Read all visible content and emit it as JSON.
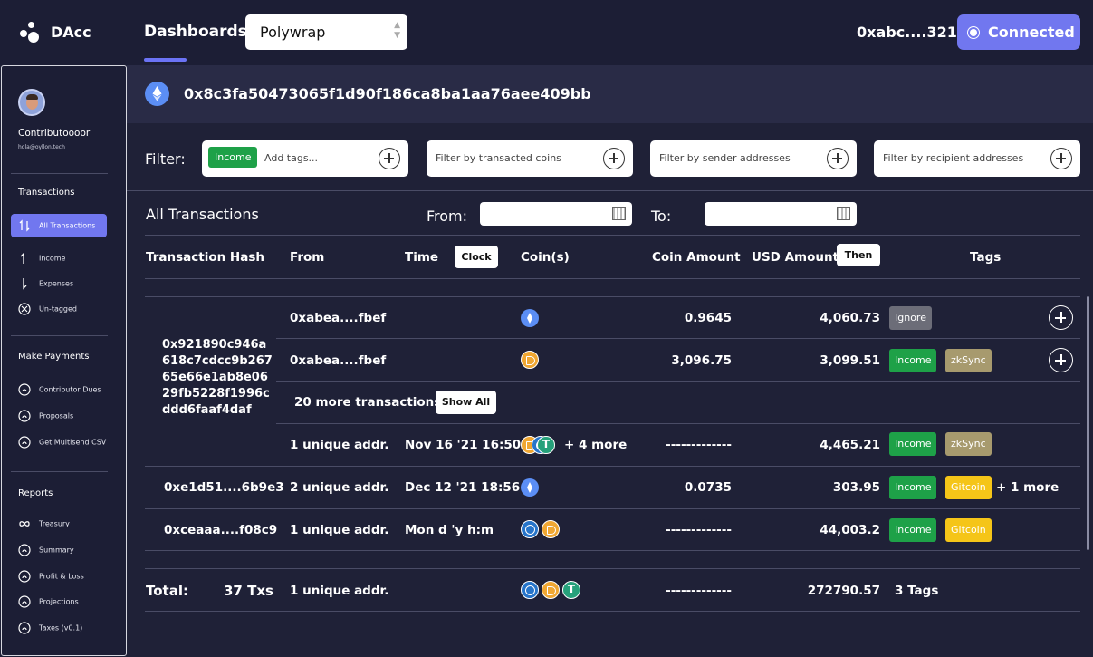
{
  "app": {
    "brand": "DAcc"
  },
  "header": {
    "dashboards_label": "Dashboards:",
    "dashboard_selected": "Polywrap",
    "wallet": "0xabc....321",
    "connected_label": "Connected"
  },
  "sidebar": {
    "user_name": "Contributoooor",
    "user_email": "hola@oyllon.tech",
    "transactions_heading": "Transactions",
    "transactions_items": [
      {
        "label": "All Transactions",
        "icon": "swap-arrows-icon"
      },
      {
        "label": "Income",
        "icon": "arrow-up-icon"
      },
      {
        "label": "Expenses",
        "icon": "arrow-down-icon"
      },
      {
        "label": "Un-tagged",
        "icon": "circle-x-icon"
      }
    ],
    "payments_heading": "Make Payments",
    "payments_items": [
      {
        "label": "Contributor Dues",
        "icon": "gauge-icon"
      },
      {
        "label": "Proposals",
        "icon": "gauge-icon"
      },
      {
        "label": "Get Multisend CSV",
        "icon": "gauge-icon"
      }
    ],
    "reports_heading": "Reports",
    "reports_items": [
      {
        "label": "Treasury",
        "icon": "infinity-icon"
      },
      {
        "label": "Summary",
        "icon": "gauge-icon"
      },
      {
        "label": "Profit & Loss",
        "icon": "gauge-icon"
      },
      {
        "label": "Projections",
        "icon": "gauge-icon"
      },
      {
        "label": "Taxes (v0.1)",
        "icon": "gauge-icon"
      }
    ]
  },
  "address_bar": {
    "address": "0x8c3fa50473065f1d90f186ca8ba1aa76aee409bb"
  },
  "filters": {
    "label": "Filter:",
    "tag_chip": "Income",
    "tags_placeholder": "Add tags...",
    "coins_placeholder": "Filter by transacted coins",
    "sender_placeholder": "Filter by sender addresses",
    "recipient_placeholder": "Filter by recipient addresses"
  },
  "table_controls": {
    "title": "All Transactions",
    "from_label": "From:",
    "to_label": "To:"
  },
  "table": {
    "headers": {
      "hash": "Transaction Hash",
      "from": "From",
      "time": "Time",
      "time_toggle": "Clock",
      "coins": "Coin(s)",
      "coin_amount": "Coin Amount",
      "usd_amount": "USD Amount",
      "usd_toggle": "Then",
      "tags": "Tags"
    },
    "group": {
      "hash": "0x921890c946a618c7cdcc9b26765e66e1ab8e0629fb5228f1996cddd6faaf4daf",
      "rows": [
        {
          "from": "0xabea....fbef",
          "coin_amount": "0.9645",
          "usd_amount": "4,060.73",
          "tags": [
            "Ignore"
          ]
        },
        {
          "from": "0xabea....fbef",
          "coin_amount": "3,096.75",
          "usd_amount": "3,099.51",
          "tags": [
            "Income",
            "zkSync"
          ]
        }
      ],
      "more_text": "20 more transactions",
      "show_all": "Show All",
      "summary": {
        "from": "1 unique addr.",
        "time": "Nov 16 '21 16:50",
        "coins_more": "+ 4 more",
        "coin_amount": "-------------",
        "usd_amount": "4,465.21",
        "tags": [
          "Income",
          "zkSync"
        ]
      }
    },
    "rows": [
      {
        "hash": "0xe1d51....6b9e3",
        "from": "2 unique addr.",
        "time": "Dec 12 '21 18:56",
        "coin_amount": "0.0735",
        "usd_amount": "303.95",
        "tags": [
          "Income",
          "Gitcoin"
        ],
        "tags_more": "+ 1 more"
      },
      {
        "hash": "0xceaaa....f08c9",
        "from": "1 unique addr.",
        "time": "Mon d 'y h:m",
        "coin_amount": "-------------",
        "usd_amount": "44,003.2",
        "tags": [
          "Income",
          "Gitcoin"
        ]
      }
    ],
    "total": {
      "label": "Total:",
      "count": "37 Txs",
      "from": "1 unique addr.",
      "coin_amount": "-------------",
      "usd_amount": "272790.57",
      "tags": "3 Tags"
    }
  },
  "colors": {
    "accent": "#7177ef",
    "income": "#1ea148",
    "gitcoin": "#f5c518",
    "zksync": "#a79a6e",
    "ignore": "#6c6d78"
  }
}
